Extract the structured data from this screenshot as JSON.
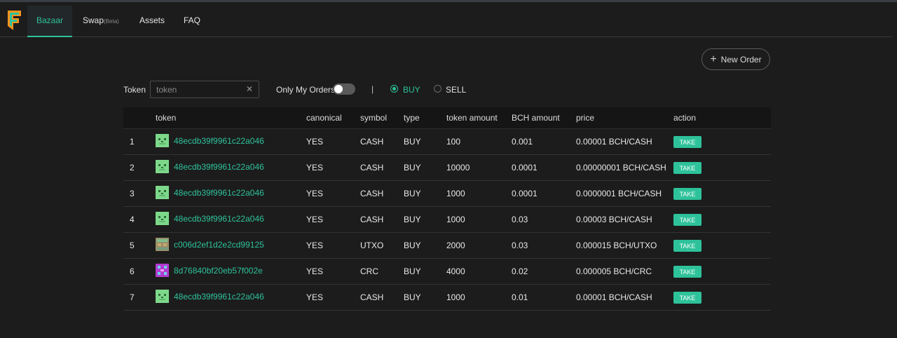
{
  "nav": {
    "tabs": [
      {
        "label": "Bazaar"
      },
      {
        "label": "Swap",
        "badge": "(Beta)"
      },
      {
        "label": "Assets"
      },
      {
        "label": "FAQ"
      }
    ]
  },
  "actions": {
    "new_order_label": "New Order"
  },
  "filters": {
    "token_label": "Token",
    "token_placeholder": "token",
    "only_my_orders_label": "Only My Orders",
    "separator": "|",
    "buy_label": "BUY",
    "sell_label": "SELL"
  },
  "table": {
    "headers": {
      "token": "token",
      "canonical": "canonical",
      "symbol": "symbol",
      "type": "type",
      "token_amount": "token amount",
      "bch_amount": "BCH amount",
      "price": "price",
      "action": "action"
    },
    "rows": [
      {
        "num": "1",
        "token": "48ecdb39f9961c22a046",
        "canonical": "YES",
        "symbol": "CASH",
        "type": "BUY",
        "token_amount": "100",
        "bch_amount": "0.001",
        "price": "0.00001 BCH/CASH",
        "action": "TAKE",
        "icon": "cash-token-icon"
      },
      {
        "num": "2",
        "token": "48ecdb39f9961c22a046",
        "canonical": "YES",
        "symbol": "CASH",
        "type": "BUY",
        "token_amount": "10000",
        "bch_amount": "0.0001",
        "price": "0.00000001 BCH/CASH",
        "action": "TAKE",
        "icon": "cash-token-icon"
      },
      {
        "num": "3",
        "token": "48ecdb39f9961c22a046",
        "canonical": "YES",
        "symbol": "CASH",
        "type": "BUY",
        "token_amount": "1000",
        "bch_amount": "0.0001",
        "price": "0.0000001 BCH/CASH",
        "action": "TAKE",
        "icon": "cash-token-icon"
      },
      {
        "num": "4",
        "token": "48ecdb39f9961c22a046",
        "canonical": "YES",
        "symbol": "CASH",
        "type": "BUY",
        "token_amount": "1000",
        "bch_amount": "0.03",
        "price": "0.00003 BCH/CASH",
        "action": "TAKE",
        "icon": "cash-token-icon"
      },
      {
        "num": "5",
        "token": "c006d2ef1d2e2cd99125",
        "canonical": "YES",
        "symbol": "UTXO",
        "type": "BUY",
        "token_amount": "2000",
        "bch_amount": "0.03",
        "price": "0.000015 BCH/UTXO",
        "action": "TAKE",
        "icon": "utxo-token-icon"
      },
      {
        "num": "6",
        "token": "8d76840bf20eb57f002e",
        "canonical": "YES",
        "symbol": "CRC",
        "type": "BUY",
        "token_amount": "4000",
        "bch_amount": "0.02",
        "price": "0.000005 BCH/CRC",
        "action": "TAKE",
        "icon": "crc-token-icon"
      },
      {
        "num": "7",
        "token": "48ecdb39f9961c22a046",
        "canonical": "YES",
        "symbol": "CASH",
        "type": "BUY",
        "token_amount": "1000",
        "bch_amount": "0.01",
        "price": "0.00001 BCH/CASH",
        "action": "TAKE",
        "icon": "cash-token-icon"
      }
    ]
  },
  "colors": {
    "accent": "#2ec29a",
    "background": "#1c1c1c",
    "logo_orange": "#f7941d",
    "logo_green": "#2ec29a"
  }
}
